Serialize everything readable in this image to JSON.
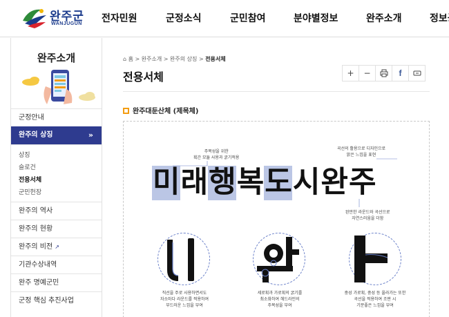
{
  "header": {
    "logo_name": "완주군",
    "logo_sub": "WANJUGUN",
    "nav": [
      "전자민원",
      "군정소식",
      "군민참여",
      "분야별정보",
      "완주소개",
      "정보공개"
    ]
  },
  "sidebar": {
    "title": "완주소개",
    "items": [
      {
        "label": "군정안내"
      },
      {
        "label": "완주의 상징",
        "active_chevron": "»"
      },
      {
        "label": "완주의 역사"
      },
      {
        "label": "완주의 현황"
      },
      {
        "label": "완주의 비전",
        "external_icon": "↗"
      },
      {
        "label": "기관수상내역"
      },
      {
        "label": "완주 명예군민"
      },
      {
        "label": "군정 핵심 추진사업"
      }
    ],
    "sub_items": [
      "상징",
      "슬로건",
      "전용서체",
      "군민헌장"
    ],
    "current_sub": "전용서체"
  },
  "breadcrumb": {
    "home_icon": "⌂",
    "items": [
      "홈",
      "완주소개",
      "완주의 상징",
      "전용서체"
    ],
    "separator": ">"
  },
  "page": {
    "title": "전용서체",
    "tools": [
      "+",
      "−",
      "print-icon",
      "facebook-icon",
      "link-icon"
    ],
    "tool_glyphs": [
      "+",
      "−",
      "⎙",
      "f",
      "⊟"
    ]
  },
  "section": {
    "heading": "완주대둔산체 (제목체)",
    "specimen_chars": [
      "미",
      "래",
      "행",
      "복",
      "도",
      "시",
      "완",
      "주"
    ],
    "highlighted": [
      0,
      2,
      4
    ],
    "annotations": {
      "top_left": [
        "주목성을 위한",
        "획간 모듈 사용과 굵기적용"
      ],
      "top_right": [
        "곡선의 활용으로 디자인으로",
        "밝은 느낌을 표현"
      ],
      "bottom_right": [
        "완만한 라운드와 곡선으로",
        "자연스러움을 더함"
      ]
    },
    "glyph_samples": [
      {
        "char": "ㅣ",
        "desc": [
          "직선을 주로 사용하면서도",
          "자소마다 라운드를 적용하여",
          "부드러운 느낌을 부여"
        ]
      },
      {
        "char": "완",
        "desc": [
          "세로획과 가로획의 굵기를",
          "최소화하여 헤드라인의",
          "주목성을 부여"
        ]
      },
      {
        "char": "ㅏ",
        "desc": [
          "중성 가로획, 중성 등 올라가는 또한",
          "곡선을 적용하여 조판 시",
          "기분좋은 느낌을 부여"
        ]
      }
    ]
  },
  "colors": {
    "brand_navy": "#2e3b8f",
    "accent_orange": "#f39c12",
    "highlight_blue": "#8da0d4"
  }
}
